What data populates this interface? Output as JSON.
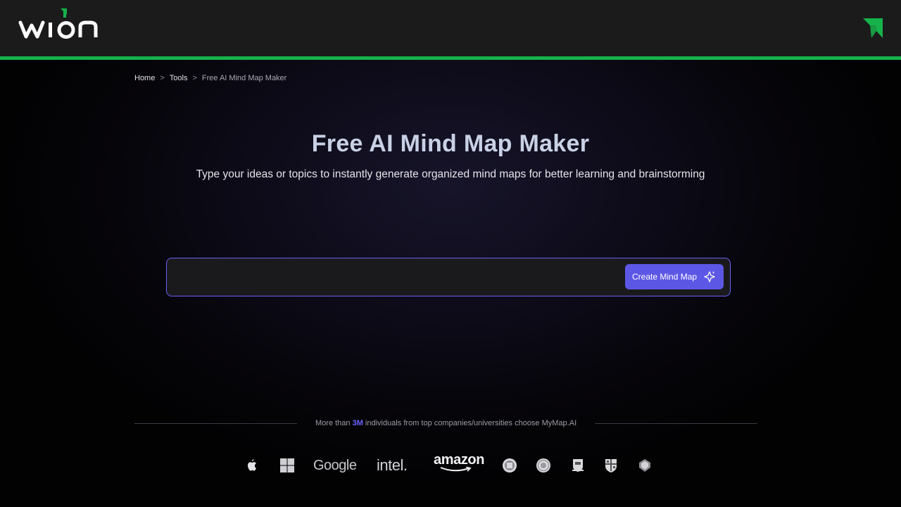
{
  "header": {
    "logo_text": "wion",
    "logo_icon": "wion-logo",
    "corner_icon": "green-arrow-icon",
    "accent_color": "#16b24b"
  },
  "breadcrumb": {
    "home": "Home",
    "tools": "Tools",
    "current": "Free AI Mind Map Maker",
    "separator": ">"
  },
  "hero": {
    "title": "Free AI Mind Map Maker",
    "subtitle": "Type your ideas or topics to instantly generate organized mind maps for better learning and brainstorming"
  },
  "input": {
    "value": "",
    "placeholder": "",
    "button_label": "Create Mind Map",
    "button_icon": "sparkle-icon",
    "button_color": "#5d57e6",
    "border_color": "#6b5ff5"
  },
  "trust": {
    "prefix": "More than ",
    "highlight": "3M",
    "suffix": " individuals from top companies/universities choose MyMap.AI",
    "highlight_color": "#6b64ff"
  },
  "logos": [
    {
      "name": "apple-logo-icon"
    },
    {
      "name": "microsoft-logo-icon"
    },
    {
      "name": "google-logo",
      "text": "Google"
    },
    {
      "name": "intel-logo",
      "text": "intel."
    },
    {
      "name": "amazon-logo",
      "text": "amazon"
    },
    {
      "name": "university-seal-1-icon"
    },
    {
      "name": "university-seal-2-icon"
    },
    {
      "name": "university-crest-1-icon"
    },
    {
      "name": "university-crest-2-icon"
    },
    {
      "name": "university-crest-3-icon"
    }
  ]
}
